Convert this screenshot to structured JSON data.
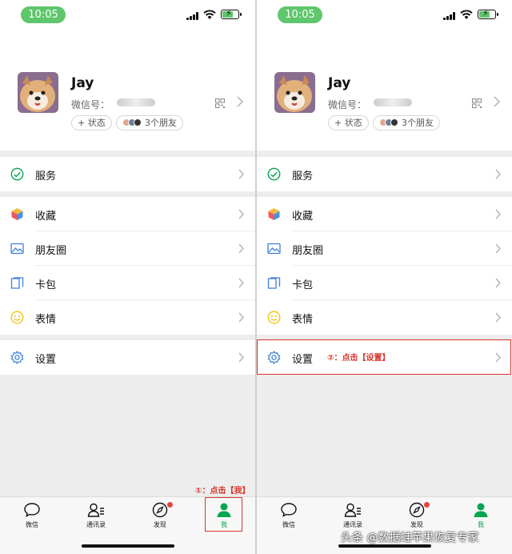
{
  "status_bar": {
    "time": "10:05"
  },
  "profile": {
    "name": "Jay",
    "wechat_id_label": "微信号：",
    "status_chip": "+ 状态",
    "friends_chip": "3个朋友"
  },
  "menu": {
    "service": "服务",
    "favorites": "收藏",
    "moments": "朋友圈",
    "cards": "卡包",
    "stickers": "表情",
    "settings": "设置"
  },
  "tabs": {
    "chats": "微信",
    "contacts": "通讯录",
    "discover": "发现",
    "me": "我"
  },
  "annotations": {
    "step1": "①：点击【我】",
    "step2": "②：点击【设置】"
  },
  "watermark": "头条 @数据蛙苹果恢复专家",
  "colors": {
    "accent": "#07a650",
    "annotation": "#d9342b",
    "badge": "#e64340",
    "time_pill": "#5ec66b"
  }
}
